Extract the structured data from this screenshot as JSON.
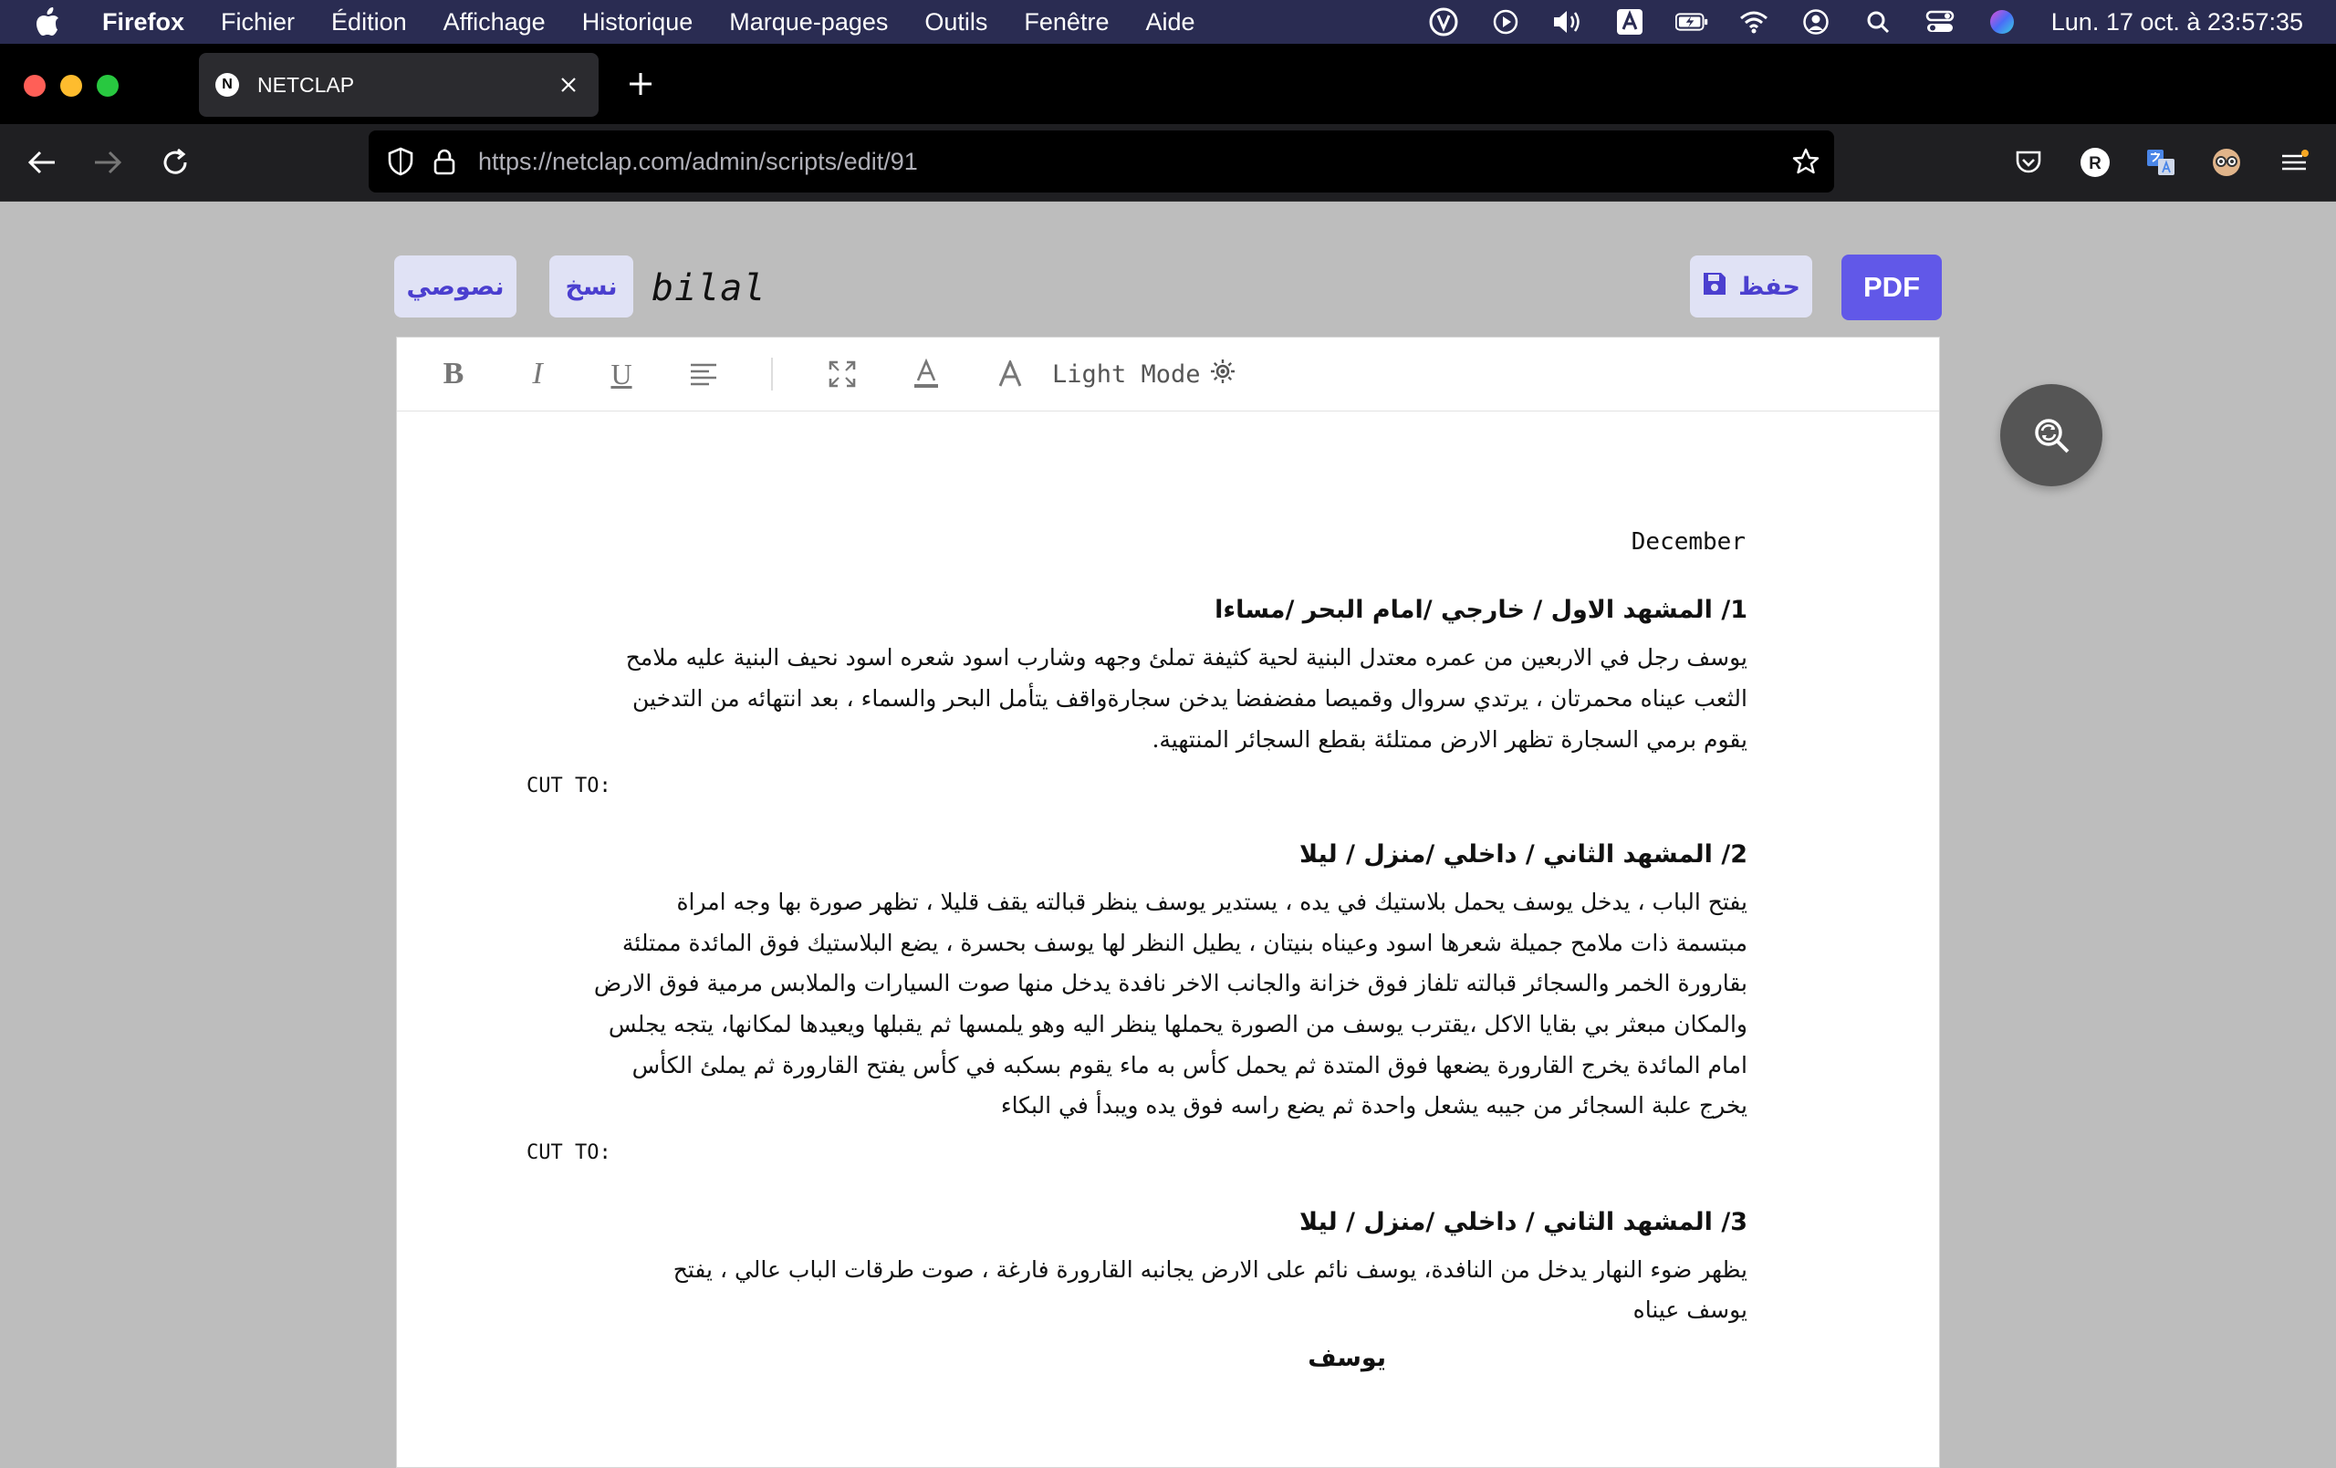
{
  "menubar": {
    "app_name": "Firefox",
    "items": [
      "Fichier",
      "Édition",
      "Affichage",
      "Historique",
      "Marque-pages",
      "Outils",
      "Fenêtre",
      "Aide"
    ],
    "clock": "Lun. 17 oct. à  23:57:35"
  },
  "browser": {
    "tab_title": "NETCLAP",
    "tab_favicon_letter": "N",
    "url_host": "https://netclap.com",
    "url_path": "/admin/scripts/edit/91",
    "profile_letter": "R"
  },
  "page": {
    "scripts_button": "نصوصي",
    "copy_button": "نسخ",
    "doc_title": "bilal",
    "save_button": "حفظ",
    "pdf_button": "PDF"
  },
  "toolbar": {
    "bold": "B",
    "italic": "I",
    "underline": "U",
    "light_mode": "Light Mode"
  },
  "script": {
    "month": "December",
    "scene1": {
      "heading": "1/ المشهد الاول / خارجي /امام البحر /مساءا",
      "lines": [
        "يوسف رجل في الاربعين من عمره معتدل البنية لحية كثيفة تملئ وجهه وشارب اسود شعره اسود نحيف البنية عليه ملامح",
        "الثعب عيناه محمرتان ، يرتدي سروال وقميصا مفضفضا يدخن سجارةواقف  يتأمل البحر والسماء ، بعد انتهائه من التدخين",
        "يقوم برمي السجارة تظهر الارض ممتلئة بقطع السجائر المنتهية."
      ],
      "transition": "CUT TO:"
    },
    "scene2": {
      "heading": "2/ المشهد الثاني / داخلي /منزل / ليلا",
      "lines": [
        "يفتح الباب ، يدخل يوسف يحمل بلاستيك في يده ، يستدير يوسف ينظر قبالته يقف قليلا ، تظهر صورة بها وجه امراة",
        "مبتسمة  ذات ملامح جميلة شعرها اسود وعيناه بنيتان ، يطيل النظر لها يوسف بحسرة ، يضع البلاستيك فوق المائدة ممتلئة",
        "بقارورة الخمر والسجائر  قبالته تلفاز فوق خزانة والجانب الاخر نافدة يدخل منها صوت السيارات والملابس مرمية فوق الارض",
        "والمكان مبعثر بي بقايا الاكل ،يقترب يوسف من الصورة يحملها ينظر اليه وهو يلمسها ثم يقبلها ويعيدها لمكانها، يتجه يجلس",
        "امام المائدة يخرج القارورة  يضعها فوق المتدة ثم يحمل كأس  به ماء يقوم بسكبه في كأس يفتح القارورة ثم يملئ الكأس",
        "يخرج علبة السجائر من جيبه يشعل واحدة ثم يضع راسه فوق يده ويبدأ في البكاء"
      ],
      "transition": "CUT TO:"
    },
    "scene3": {
      "heading": "3/ المشهد الثاني / داخلي /منزل / ليلا",
      "lines": [
        "يظهر ضوء النهار يدخل من النافدة، يوسف نائم على الارض يجانبه القارورة فارغة ، صوت طرقات الباب عالي ، يفتح",
        "يوسف عيناه"
      ],
      "character": "يوسف"
    }
  }
}
